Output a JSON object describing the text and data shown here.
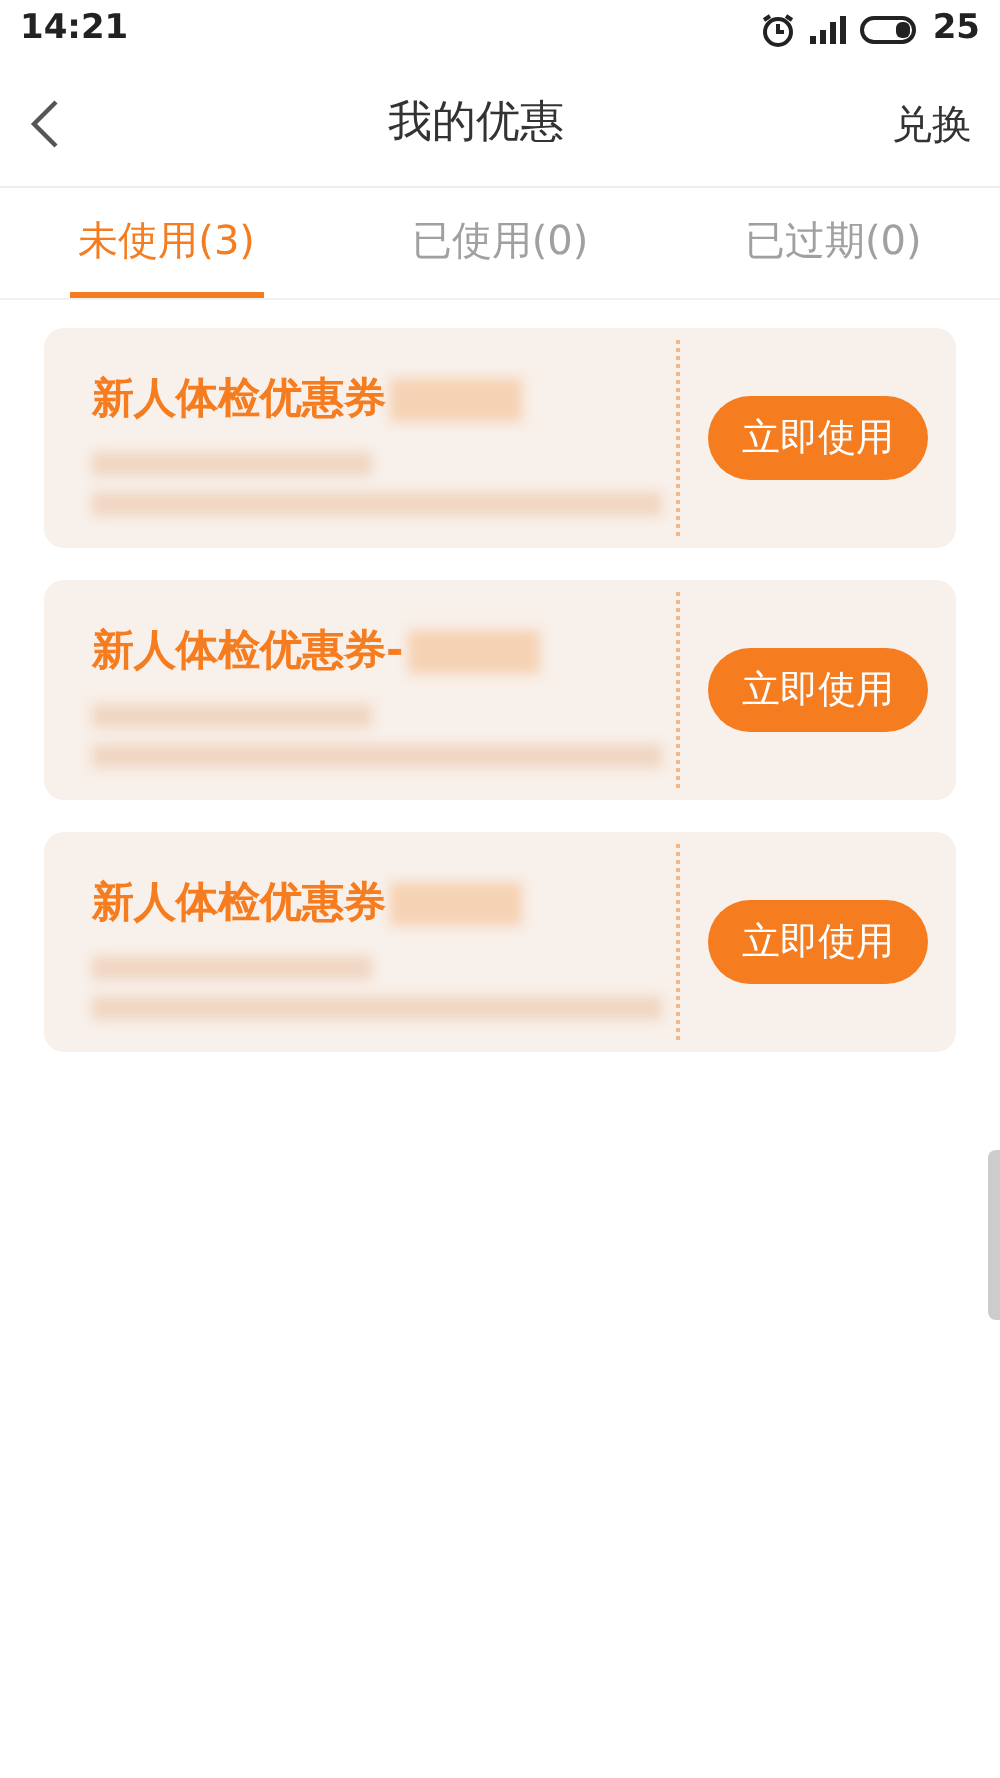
{
  "status_bar": {
    "time": "14:21",
    "battery": "25"
  },
  "header": {
    "title": "我的优惠",
    "action": "兑换"
  },
  "tabs": [
    {
      "label": "未使用(3)",
      "selected": true
    },
    {
      "label": "已使用(0)",
      "selected": false
    },
    {
      "label": "已过期(0)",
      "selected": false
    }
  ],
  "coupons": [
    {
      "title": "新人体检优惠券",
      "button": "立即使用"
    },
    {
      "title": "新人体检优惠券-",
      "button": "立即使用"
    },
    {
      "title": "新人体检优惠券",
      "button": "立即使用"
    }
  ]
}
